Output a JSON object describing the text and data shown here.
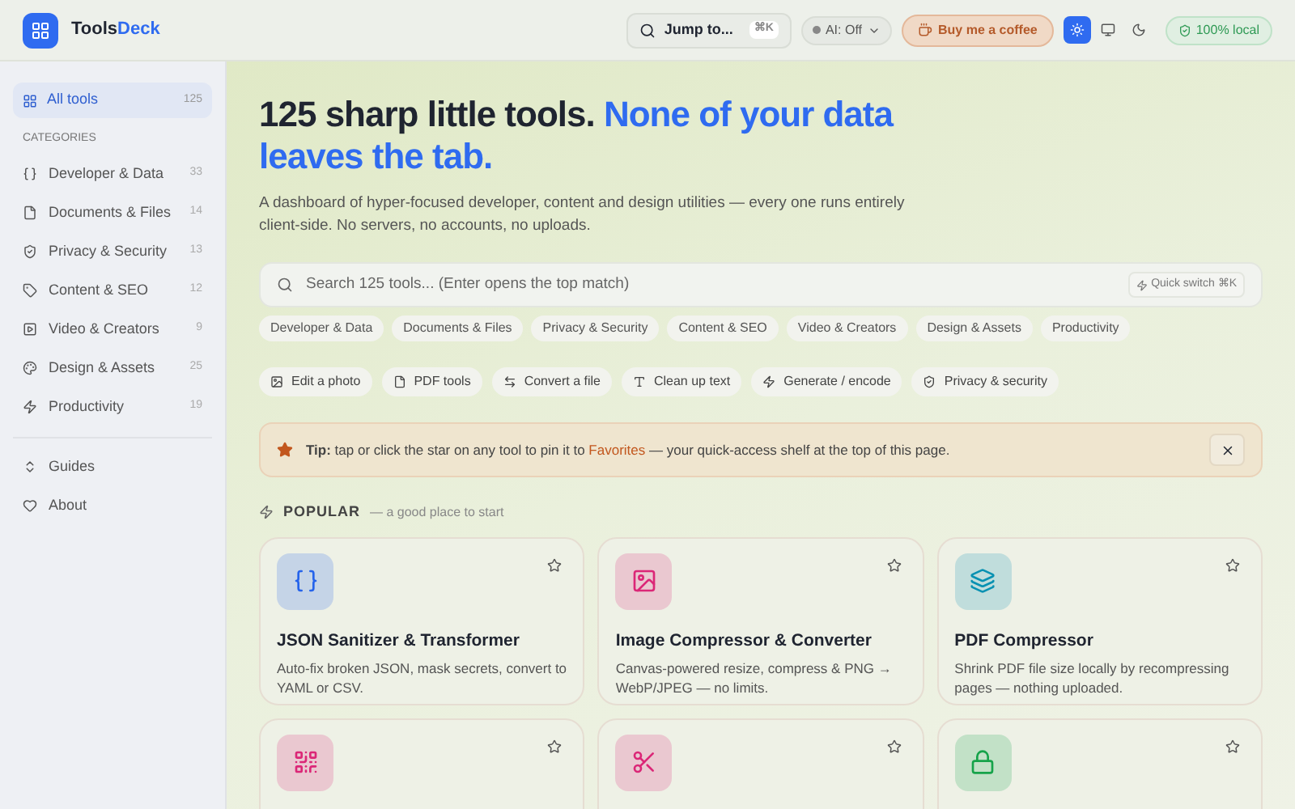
{
  "brand": {
    "name_plain": "Tools",
    "name_accent": "Deck"
  },
  "header": {
    "jump": {
      "label": "Jump to...",
      "shortcut": "⌘K"
    },
    "ai": {
      "label": "AI: Off",
      "on": false
    },
    "coffee": "Buy me a coffee",
    "themes": [
      {
        "kind": "light",
        "selected": true
      },
      {
        "kind": "system",
        "selected": false
      },
      {
        "kind": "dark",
        "selected": false
      }
    ],
    "local_badge": "100% local"
  },
  "sidebar": {
    "all": {
      "label": "All tools",
      "count": "125",
      "selected": true
    },
    "heading": "CATEGORIES",
    "items": [
      {
        "label": "Developer & Data",
        "count": "33",
        "selected": false
      },
      {
        "label": "Documents & Files",
        "count": "14",
        "selected": false
      },
      {
        "label": "Privacy & Security",
        "count": "13",
        "selected": false
      },
      {
        "label": "Content & SEO",
        "count": "12",
        "selected": false
      },
      {
        "label": "Video & Creators",
        "count": "9",
        "selected": false
      },
      {
        "label": "Design & Assets",
        "count": "25",
        "selected": false
      },
      {
        "label": "Productivity",
        "count": "19",
        "selected": false
      }
    ],
    "links": [
      "Guides",
      "About"
    ]
  },
  "hero": {
    "title": "125 sharp little tools.",
    "title_accent": "None of your data leaves the tab.",
    "description": "A dashboard of hyper-focused developer, content and design utilities — every one runs entirely client-side. No servers, no accounts, no uploads."
  },
  "search": {
    "placeholder": "Search 125 tools... (Enter opens the top match)",
    "quick_switch": "Quick switch ⌘K"
  },
  "category_chips": [
    "Developer & Data",
    "Documents & Files",
    "Privacy & Security",
    "Content & SEO",
    "Video & Creators",
    "Design & Assets",
    "Productivity"
  ],
  "task_chips": [
    "Edit a photo",
    "PDF tools",
    "Convert a file",
    "Clean up text",
    "Generate / encode",
    "Privacy & security"
  ],
  "tip": {
    "text": "**Tip:** tap or click the star on any tool to pin it to ",
    "link": "Favorites",
    "rest": " — your quick-access shelf at the top of this page."
  },
  "popular": {
    "heading": "POPULAR",
    "subheading": "— a good place to start"
  },
  "cards": [
    {
      "title": "JSON Sanitizer & Transformer",
      "description": "Auto-fix broken JSON, mask secrets, convert to YAML or CSV.",
      "color": "#2563eb",
      "favorite": false
    },
    {
      "title": "Image Compressor & Converter",
      "description": "Canvas-powered resize, compress & PNG → WebP/JPEG — no limits.",
      "color": "#db2777",
      "favorite": false
    },
    {
      "title": "PDF Compressor",
      "description": "Shrink PDF file size locally by recompressing pages — nothing uploaded.",
      "color": "#0891b2",
      "favorite": false
    },
    {
      "color": "#db2777",
      "favorite": false
    },
    {
      "color": "#db2777",
      "favorite": false
    },
    {
      "color": "#16a34a",
      "favorite": false
    }
  ]
}
